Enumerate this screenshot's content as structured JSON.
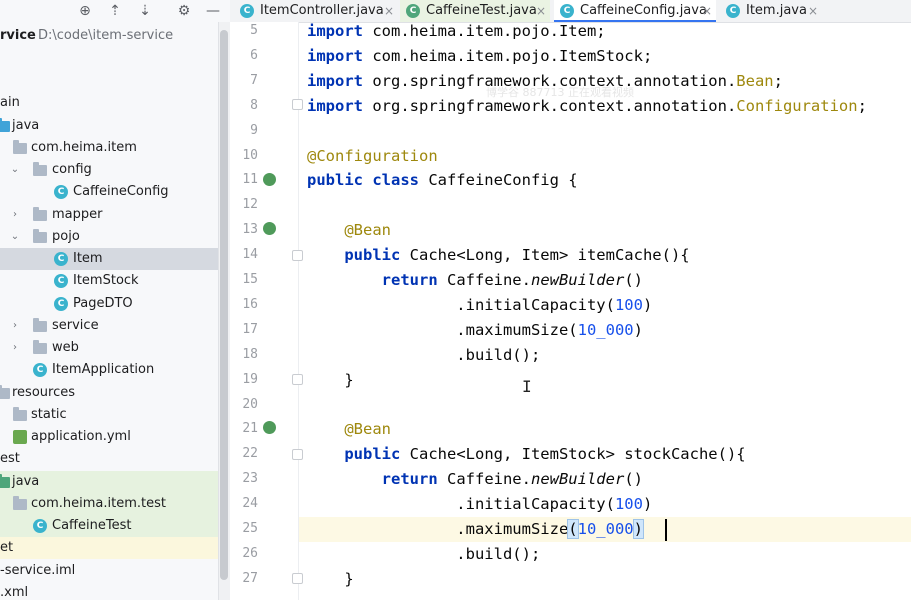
{
  "tabs": [
    {
      "label": "ItemController.java",
      "glyph": "C",
      "modified": false,
      "active": false
    },
    {
      "label": "CaffeineTest.java",
      "glyph": "C",
      "modified": true,
      "active": false
    },
    {
      "label": "CaffeineConfig.java",
      "glyph": "C",
      "modified": false,
      "active": true
    },
    {
      "label": "Item.java",
      "glyph": "C",
      "modified": false,
      "active": false
    }
  ],
  "tab_close": "×",
  "toolbar": {
    "locate": "⊕",
    "expand": "⇡",
    "collapse": "⇣",
    "settings": "⚙",
    "hide": "—"
  },
  "tree": {
    "root_name": "rvice",
    "root_path": "D:\\code\\item-service",
    "items": [
      {
        "label": "ain"
      },
      {
        "label": "java"
      },
      {
        "label": "com.heima.item"
      },
      {
        "label": "config"
      },
      {
        "label": "CaffeineConfig"
      },
      {
        "label": "mapper"
      },
      {
        "label": "pojo"
      },
      {
        "label": "Item"
      },
      {
        "label": "ItemStock"
      },
      {
        "label": "PageDTO"
      },
      {
        "label": "service"
      },
      {
        "label": "web"
      },
      {
        "label": "ItemApplication"
      },
      {
        "label": "resources"
      },
      {
        "label": "static"
      },
      {
        "label": "application.yml"
      },
      {
        "label": "est"
      },
      {
        "label": "java"
      },
      {
        "label": "com.heima.item.test"
      },
      {
        "label": "CaffeineTest"
      },
      {
        "label": "et"
      },
      {
        "label": "-service.iml"
      },
      {
        "label": ".xml"
      }
    ]
  },
  "editor": {
    "line_numbers": [
      "5",
      "6",
      "7",
      "8",
      "9",
      "10",
      "11",
      "12",
      "13",
      "14",
      "15",
      "16",
      "17",
      "18",
      "19",
      "20",
      "21",
      "22",
      "23",
      "24",
      "25",
      "26",
      "27"
    ],
    "lines": [
      {
        "kw": "import",
        "rest": " com.heima.item.pojo.Item;"
      },
      {
        "kw": "import",
        "rest": " com.heima.item.pojo.ItemStock;"
      },
      {
        "kw": "import",
        "rest": " org.springframework.context.annotation.",
        "ann": "Bean",
        "tail": ";"
      },
      {
        "kw": "import",
        "rest": " org.springframework.context.annotation.",
        "ann": "Configuration",
        "tail": ";"
      },
      {},
      {
        "annotation": "@Configuration"
      },
      {
        "kw": "public class",
        "rest": " CaffeineConfig {"
      },
      {},
      {
        "annotation": "    @Bean"
      },
      {
        "kw": "    public",
        "rest": " Cache<Long, Item> itemCache(){"
      },
      {
        "kw": "        return",
        "rest": " Caffeine.",
        "italic": "newBuilder",
        "tail": "()"
      },
      {
        "rest": "                .initialCapacity(",
        "num": "100",
        "tail": ")"
      },
      {
        "rest": "                .maximumSize(",
        "num": "10_000",
        "tail": ")"
      },
      {
        "rest": "                .build();"
      },
      {
        "rest": "    }"
      },
      {},
      {
        "annotation": "    @Bean"
      },
      {
        "kw": "    public",
        "rest": " Cache<Long, ItemStock> stockCache(){"
      },
      {
        "kw": "        return",
        "rest": " Caffeine.",
        "italic": "newBuilder",
        "tail": "()"
      },
      {
        "rest": "                .initialCapacity(",
        "num": "100",
        "tail": ")"
      },
      {
        "rest": "                .maximumSize",
        "bopen": "(",
        "num": "10_000",
        "bclose": ")"
      },
      {
        "rest": "                .build();"
      },
      {
        "rest": "    }"
      }
    ]
  },
  "watermark": "博学谷 887713 正在观看视频"
}
